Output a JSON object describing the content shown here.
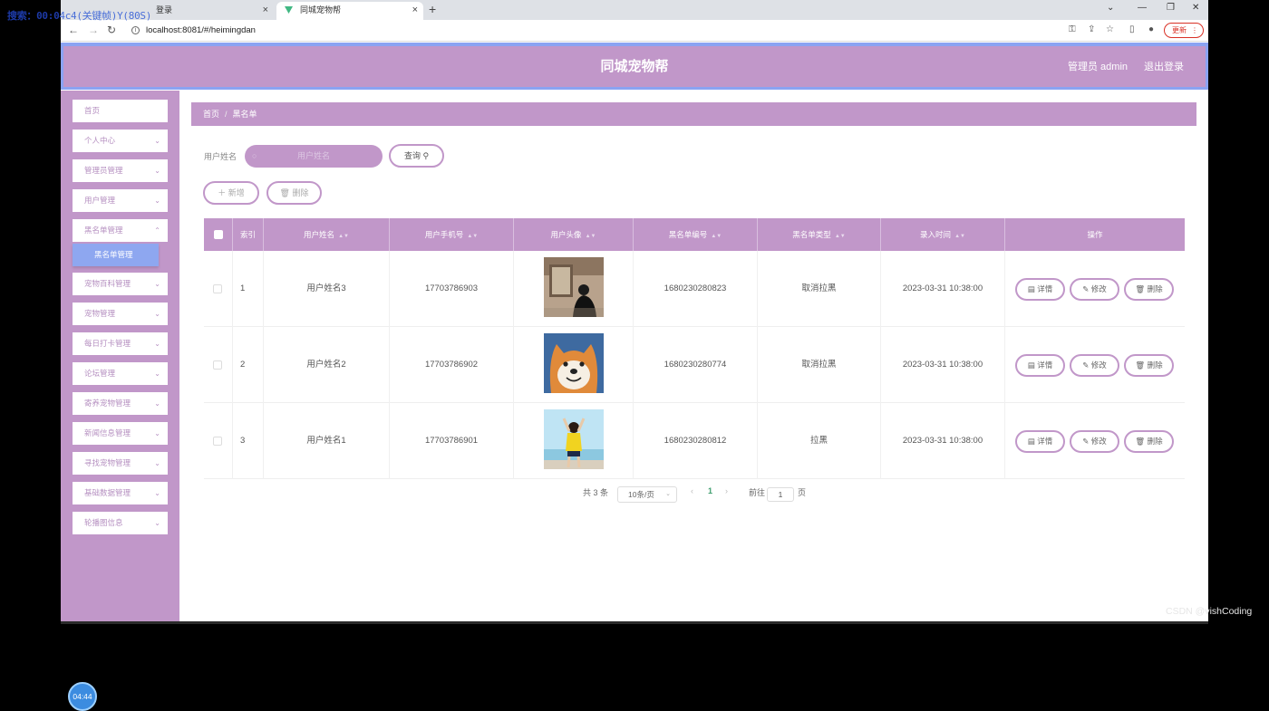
{
  "overlay": {
    "prefix": "搜索：00:0",
    "rest": "4c4(关键帧)Y(80S)"
  },
  "tabs": [
    {
      "label": "登录"
    },
    {
      "label": "同城宠物帮"
    }
  ],
  "address": {
    "url": "localhost:8081/#/heimingdan",
    "update_label": "更新"
  },
  "header": {
    "title": "同城宠物帮",
    "admin_label": "管理员 admin",
    "logout_label": "退出登录"
  },
  "sidebar": {
    "items": [
      {
        "label": "首页",
        "chevron": false
      },
      {
        "label": "个人中心",
        "chevron": true
      },
      {
        "label": "管理员管理",
        "chevron": true
      },
      {
        "label": "用户管理",
        "chevron": true
      },
      {
        "label": "黑名单管理",
        "chevron": true
      },
      {
        "label": "宠物百科管理",
        "chevron": true
      },
      {
        "label": "宠物管理",
        "chevron": true
      },
      {
        "label": "每日打卡管理",
        "chevron": true
      },
      {
        "label": "论坛管理",
        "chevron": true
      },
      {
        "label": "寄养宠物管理",
        "chevron": true
      },
      {
        "label": "新闻信息管理",
        "chevron": true
      },
      {
        "label": "寻找宠物管理",
        "chevron": true
      },
      {
        "label": "基础数据管理",
        "chevron": true
      },
      {
        "label": "轮播图信息",
        "chevron": true
      }
    ],
    "active_sub": "黑名单管理",
    "timer": "04:44"
  },
  "breadcrumb": {
    "home": "首页",
    "sep": "/",
    "current": "黑名单"
  },
  "search": {
    "label": "用户姓名",
    "placeholder": "用户姓名",
    "query_button": "查询"
  },
  "actions": {
    "add": "新增",
    "delete": "删除"
  },
  "table": {
    "headers": [
      "索引",
      "用户姓名",
      "用户手机号",
      "用户头像",
      "黑名单编号",
      "黑名单类型",
      "录入时间",
      "操作"
    ],
    "rows": [
      {
        "index": "1",
        "name": "用户姓名3",
        "phone": "17703786903",
        "avatar": "photo-person-dark",
        "code": "1680230280823",
        "type": "取消拉黑",
        "time": "2023-03-31 10:38:00"
      },
      {
        "index": "2",
        "name": "用户姓名2",
        "phone": "17703786902",
        "avatar": "photo-shiba-dog",
        "code": "1680230280774",
        "type": "取消拉黑",
        "time": "2023-03-31 10:38:00"
      },
      {
        "index": "3",
        "name": "用户姓名1",
        "phone": "17703786901",
        "avatar": "photo-girl-yellow",
        "code": "1680230280812",
        "type": "拉黑",
        "time": "2023-03-31 10:38:00"
      }
    ],
    "row_actions": {
      "detail": "详情",
      "edit": "修改",
      "delete": "删除"
    }
  },
  "pagination": {
    "total": "共 3 条",
    "page_size": "10条/页",
    "current_page": "1",
    "goto_prefix": "前往",
    "goto_value": "1",
    "goto_suffix": "页"
  },
  "watermark": "CSDN @vishCoding",
  "colors": {
    "accent": "#c197c9",
    "header_border": "#8ba3f2",
    "submenu": "#8ea7f0"
  }
}
